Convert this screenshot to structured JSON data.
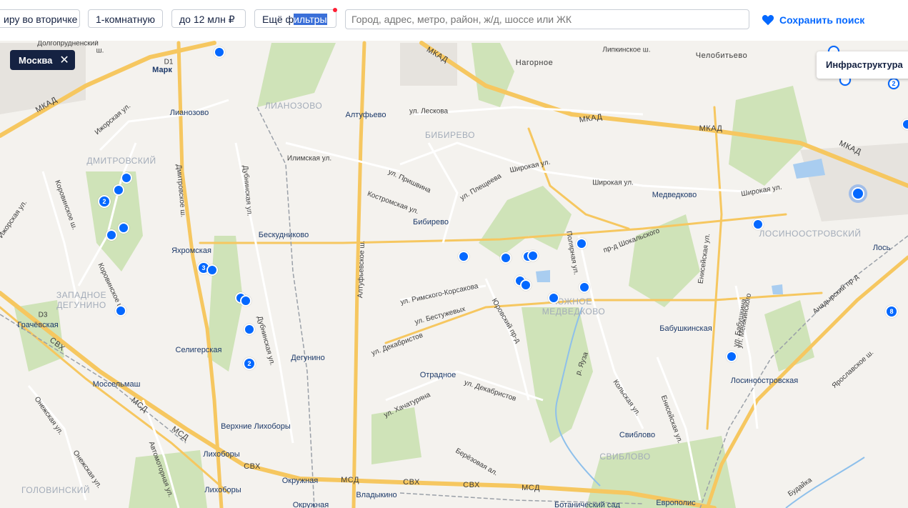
{
  "filters": {
    "deal": "иру во вторичке",
    "rooms": "1-комнатную",
    "price": "до 12 млн ₽",
    "more_a": "Ещё ф",
    "more_b": "ильтры",
    "search_placeholder": "Город, адрес, метро, район, ж/д, шоссе или ЖК",
    "save_label": "Сохранить поиск"
  },
  "map": {
    "region_chip": "Москва",
    "region_close": "✕",
    "infrastructure": "Инфраструктура",
    "labels": [
      {
        "t": "Долгопрудненский",
        "c": "road"
      },
      {
        "t": "ш.",
        "c": "road"
      },
      {
        "t": "Марк",
        "c": "station"
      },
      {
        "t": "D1",
        "c": "road"
      },
      {
        "t": "Лианозово",
        "c": "metro"
      },
      {
        "t": "ЛИАНОЗОВО",
        "c": "district"
      },
      {
        "t": "Алтуфьево",
        "c": "metro"
      },
      {
        "t": "ул. Лескова",
        "c": "road"
      },
      {
        "t": "МКАД",
        "c": "big"
      },
      {
        "t": "Липкинское ш.",
        "c": "road"
      },
      {
        "t": "Челобитьево",
        "c": "big"
      },
      {
        "t": "Нагорное",
        "c": "big"
      },
      {
        "t": "МКАД",
        "c": "big"
      },
      {
        "t": "МКАД",
        "c": "big"
      },
      {
        "t": "МКАД",
        "c": "big"
      },
      {
        "t": "МКАД",
        "c": "big"
      },
      {
        "t": "Ижорская ул.",
        "c": "road"
      },
      {
        "t": "ДМИТРОВСКИЙ",
        "c": "district"
      },
      {
        "t": "БИБИРЕВО",
        "c": "district"
      },
      {
        "t": "Илимская ул.",
        "c": "road"
      },
      {
        "t": "ул. Пришвина",
        "c": "road"
      },
      {
        "t": "ул. Плещеева",
        "c": "road"
      },
      {
        "t": "Широкая ул.",
        "c": "road"
      },
      {
        "t": "Широкая ул.",
        "c": "road"
      },
      {
        "t": "Широкая ул.",
        "c": "road"
      },
      {
        "t": "Медведково",
        "c": "metro"
      },
      {
        "t": "Костромская ул.",
        "c": "road"
      },
      {
        "t": "Бибирево",
        "c": "metro"
      },
      {
        "t": "Бескудниково",
        "c": "metro"
      },
      {
        "t": "Коровинское ш.",
        "c": "road"
      },
      {
        "t": "Ижорская ул.",
        "c": "road"
      },
      {
        "t": "Дмитровское ш.",
        "c": "road"
      },
      {
        "t": "Дубнинская ул.",
        "c": "road"
      },
      {
        "t": "Алтуфьевское ш.",
        "c": "road"
      },
      {
        "t": "Яхромская",
        "c": "metro"
      },
      {
        "t": "ЛОСИНООСТРОВСКИЙ",
        "c": "district"
      },
      {
        "t": "Лось",
        "c": "metro"
      },
      {
        "t": "пр-д Шокальского",
        "c": "road"
      },
      {
        "t": "Полярная ул.",
        "c": "road"
      },
      {
        "t": "Енисейская ул.",
        "c": "road"
      },
      {
        "t": "ЗАПАДНОЕ",
        "c": "district"
      },
      {
        "t": "ДЕГУНИНО",
        "c": "district"
      },
      {
        "t": "Коровинское ш.",
        "c": "road"
      },
      {
        "t": "Грачёвская",
        "c": "metro"
      },
      {
        "t": "D3",
        "c": "road"
      },
      {
        "t": "Дубнинская ул.",
        "c": "road"
      },
      {
        "t": "ул. Римского-Корсакова",
        "c": "road"
      },
      {
        "t": "ул. Бестужевых",
        "c": "road"
      },
      {
        "t": "Юровский пр-д",
        "c": "road"
      },
      {
        "t": "ЮЖНОЕ",
        "c": "district"
      },
      {
        "t": "МЕДВЕДКОВО",
        "c": "district"
      },
      {
        "t": "Бабушкинская",
        "c": "metro"
      },
      {
        "t": "ул. Менжинского",
        "c": "road"
      },
      {
        "t": "Анадырский пр-д",
        "c": "road"
      },
      {
        "t": "ул. Декабристов",
        "c": "road"
      },
      {
        "t": "Селигерская",
        "c": "metro"
      },
      {
        "t": "Дегунино",
        "c": "metro"
      },
      {
        "t": "СВХ",
        "c": "big"
      },
      {
        "t": "Отрадное",
        "c": "metro"
      },
      {
        "t": "р. Яуза",
        "c": "road"
      },
      {
        "t": "ул. Бабушкина",
        "c": "road"
      },
      {
        "t": "Ярославское ш.",
        "c": "road"
      },
      {
        "t": "Лосиноостровская",
        "c": "metro"
      },
      {
        "t": "Мосcельмаш",
        "c": "metro"
      },
      {
        "t": "ул. Декабристов",
        "c": "road"
      },
      {
        "t": "ул. Хачатуряна",
        "c": "road"
      },
      {
        "t": "Кольская ул.",
        "c": "road"
      },
      {
        "t": "Енисейская ул.",
        "c": "road"
      },
      {
        "t": "Онежская ул.",
        "c": "road"
      },
      {
        "t": "МСД",
        "c": "big"
      },
      {
        "t": "Верхние Лихоборы",
        "c": "metro"
      },
      {
        "t": "Свиблово",
        "c": "metro"
      },
      {
        "t": "МСД",
        "c": "big"
      },
      {
        "t": "Автомоторная ул.",
        "c": "road"
      },
      {
        "t": "Лихоборы",
        "c": "metro"
      },
      {
        "t": "СВХ",
        "c": "big"
      },
      {
        "t": "Берёзовая ал.",
        "c": "road"
      },
      {
        "t": "СВИБЛОВО",
        "c": "district"
      },
      {
        "t": "Онежская ул.",
        "c": "road"
      },
      {
        "t": "Окружная",
        "c": "metro"
      },
      {
        "t": "МСД",
        "c": "big"
      },
      {
        "t": "СВХ",
        "c": "big"
      },
      {
        "t": "СВХ",
        "c": "big"
      },
      {
        "t": "МСД",
        "c": "big"
      },
      {
        "t": "ГОЛОВИНСКИЙ",
        "c": "district"
      },
      {
        "t": "Лихоборы",
        "c": "metro"
      },
      {
        "t": "Владыкино",
        "c": "metro"
      },
      {
        "t": "Европолис",
        "c": "metro"
      },
      {
        "t": "Окружная",
        "c": "metro"
      },
      {
        "t": "Ботанический сад",
        "c": "metro"
      },
      {
        "t": "Будайка",
        "c": "road"
      }
    ],
    "pins": [
      {
        "t": "",
        "k": "pin"
      },
      {
        "t": "",
        "k": "pin"
      },
      {
        "t": "",
        "k": "pin"
      },
      {
        "t": "2",
        "k": "cluster"
      },
      {
        "t": "",
        "k": "pin"
      },
      {
        "t": "",
        "k": "pin"
      },
      {
        "t": "3",
        "k": "cluster"
      },
      {
        "t": "",
        "k": "pin"
      },
      {
        "t": "",
        "k": "pin"
      },
      {
        "t": "",
        "k": "pin"
      },
      {
        "t": "",
        "k": "pin"
      },
      {
        "t": "",
        "k": "pin"
      },
      {
        "t": "2",
        "k": "cluster"
      },
      {
        "t": "",
        "k": "pin"
      },
      {
        "t": "",
        "k": "pin"
      },
      {
        "t": "",
        "k": "pin"
      },
      {
        "t": "",
        "k": "pin"
      },
      {
        "t": "",
        "k": "pin"
      },
      {
        "t": "",
        "k": "pin"
      },
      {
        "t": "",
        "k": "pin"
      },
      {
        "t": "",
        "k": "pin"
      },
      {
        "t": "",
        "k": "pin"
      },
      {
        "t": "",
        "k": "pin"
      },
      {
        "t": "",
        "k": "pin"
      },
      {
        "t": "",
        "k": "sel"
      },
      {
        "t": "",
        "k": "pin"
      },
      {
        "t": "8",
        "k": "cluster"
      },
      {
        "t": "2",
        "k": "outline"
      },
      {
        "t": "",
        "k": "outline"
      },
      {
        "t": "",
        "k": "outline"
      }
    ]
  }
}
